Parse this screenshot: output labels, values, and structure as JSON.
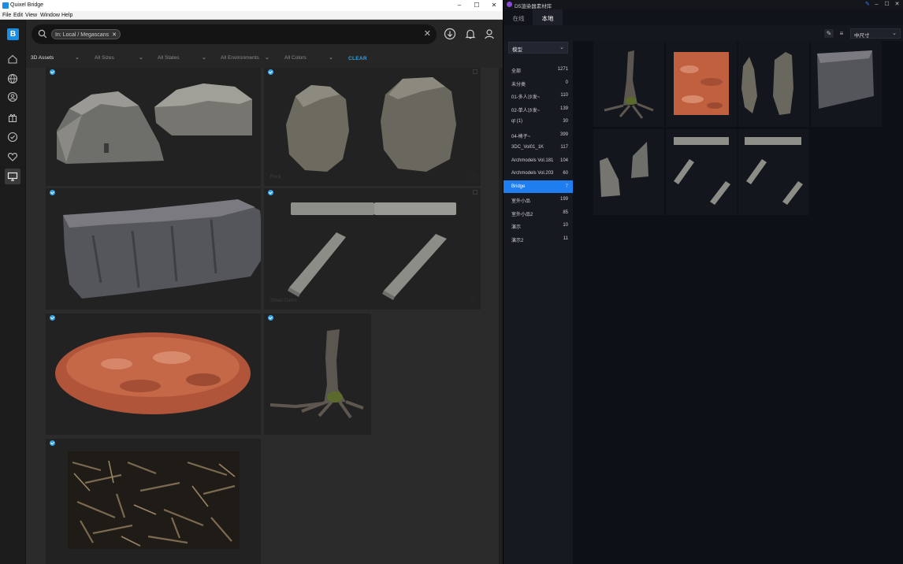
{
  "quixel": {
    "title": "Quixel Bridge",
    "menu": [
      "File",
      "Edit",
      "View",
      "Window",
      "Help"
    ],
    "search_chip": "In: Local / Megascans",
    "filters": {
      "category": "3D Assets",
      "sizes": "All Sizes",
      "states": "All States",
      "environments": "All Environments",
      "colors": "All Colors",
      "clear": "CLEAR"
    },
    "cards": [
      {
        "label": ""
      },
      {
        "label": "Rock"
      },
      {
        "label": ""
      },
      {
        "label": "Street Curbs"
      },
      {
        "label": ""
      },
      {
        "label": ""
      },
      {
        "label": ""
      }
    ],
    "colors": {
      "accent": "#2fa3e8",
      "brand": "#1a8de4"
    }
  },
  "d5": {
    "title": "D5渲染器素材库",
    "tabs": [
      "在线",
      "本地"
    ],
    "size_select": "中尺寸",
    "category_select": "模型",
    "libraries": [
      {
        "name": "全部",
        "count": "1271"
      },
      {
        "name": "未分类",
        "count": "0"
      },
      {
        "name": "01-多人沙发~",
        "count": "110"
      },
      {
        "name": "02-单人沙发~",
        "count": "139"
      },
      {
        "name": "qt (1)",
        "count": "30"
      },
      {
        "name": "04-椅子~",
        "count": "399"
      },
      {
        "name": "3DC_Vol01_1K",
        "count": "117"
      },
      {
        "name": "Archmodels Vol.181",
        "count": "104"
      },
      {
        "name": "Archmodels Vol.203",
        "count": "60"
      },
      {
        "name": "Bridge",
        "count": "7"
      },
      {
        "name": "室外小品",
        "count": "199"
      },
      {
        "name": "室外小品2",
        "count": "85"
      },
      {
        "name": "演示",
        "count": "10"
      },
      {
        "name": "演示2",
        "count": "11"
      }
    ],
    "active_library": "Bridge",
    "colors": {
      "accent": "#1e7ef0"
    }
  }
}
